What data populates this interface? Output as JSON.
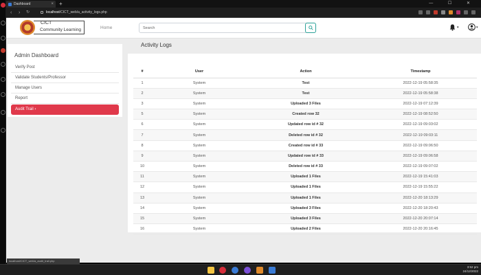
{
  "browser": {
    "tab_title": "Dashboard",
    "url_host": "localhost",
    "url_path": "/CICT_web/a_activity_logs.php"
  },
  "header": {
    "brand_line1": "CICT",
    "brand_line2": "Community Learning",
    "home_label": "Home",
    "search_placeholder": "Search"
  },
  "sidebar": {
    "title": "Admin Dashboard",
    "items": [
      {
        "label": "Verify Post"
      },
      {
        "label": "Validate Students/Professor"
      },
      {
        "label": "Manage Users"
      },
      {
        "label": "Report"
      },
      {
        "label": "Audit Trail ›"
      }
    ]
  },
  "main": {
    "title": "Activity Logs",
    "columns": [
      "#",
      "User",
      "Action",
      "Timestamp"
    ],
    "rows": [
      [
        "1",
        "System",
        "Test",
        "2022-12-19 05:58:35"
      ],
      [
        "2",
        "System",
        "Test",
        "2022-12-19 05:58:38"
      ],
      [
        "3",
        "System",
        "Uploaded 3 Files",
        "2022-12-19 07:12:39"
      ],
      [
        "5",
        "System",
        "Created row 32",
        "2022-12-19 08:52:50"
      ],
      [
        "6",
        "System",
        "Updated row id # 32",
        "2022-12-19 09:03:02"
      ],
      [
        "7",
        "System",
        "Deleted row id # 32",
        "2022-12-19 09:03:11"
      ],
      [
        "8",
        "System",
        "Created row id # 33",
        "2022-12-19 09:06:50"
      ],
      [
        "9",
        "System",
        "Updated row id # 33",
        "2022-12-19 09:06:58"
      ],
      [
        "10",
        "System",
        "Deleted row id # 33",
        "2022-12-19 09:07:02"
      ],
      [
        "11",
        "System",
        "Uploaded 1 Files",
        "2022-12-19 15:41:03"
      ],
      [
        "12",
        "System",
        "Uploaded 1 Files",
        "2022-12-19 15:55:22"
      ],
      [
        "13",
        "System",
        "Uploaded 1 Files",
        "2022-12-20 18:13:29"
      ],
      [
        "14",
        "System",
        "Uploaded 3 Files",
        "2022-12-20 18:20:43"
      ],
      [
        "15",
        "System",
        "Uploaded 3 Files",
        "2022-12-20 20:07:14"
      ],
      [
        "16",
        "System",
        "Uploaded 2 Files",
        "2022-12-20 20:16:45"
      ]
    ]
  },
  "status_url": "localhost/CICT_web/a_audit_trail.php",
  "taskbar": {
    "time": "3:52 pm",
    "date": "24/12/2022"
  },
  "colors": {
    "accent": "#e0394b",
    "search_border": "#2aa198",
    "page_bg": "#ececec"
  },
  "icons": [
    "search-icon",
    "bell-icon",
    "user-circle-icon",
    "lock-icon",
    "back-icon",
    "forward-icon",
    "reload-icon",
    "home-icon",
    "close-icon",
    "chevron-down-icon"
  ]
}
